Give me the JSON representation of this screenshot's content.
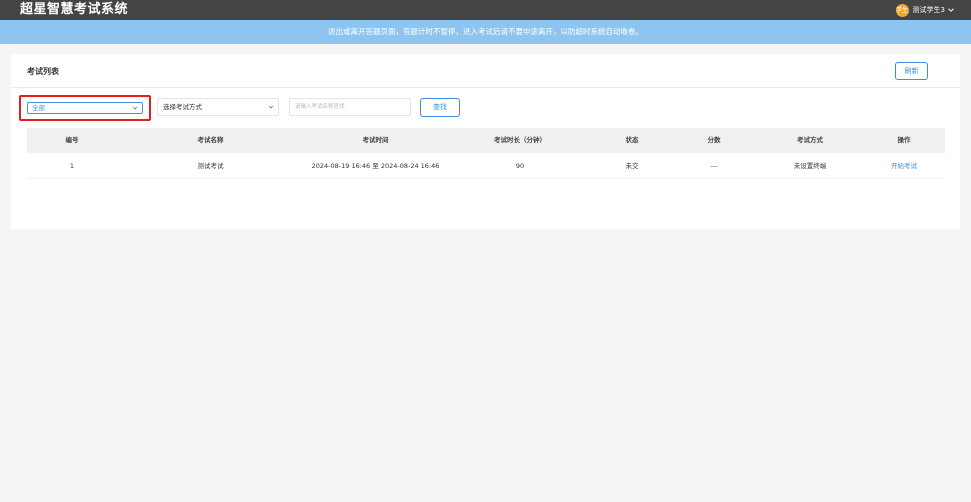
{
  "header": {
    "app_title": "超星智慧考试系统",
    "avatar_text": "学生",
    "user_name": "测试学生3"
  },
  "notice": "退出或离开答题页面，答题计时不暂停，进入考试后请不要中途离开，以防超时系统自动收卷。",
  "panel": {
    "title": "考试列表",
    "refresh_label": "刷新"
  },
  "filters": {
    "status_value": "全部",
    "mode_value": "选择考试方式",
    "search_placeholder": "请输入考试名称查找",
    "search_label": "查找"
  },
  "table": {
    "columns": [
      "编号",
      "考试名称",
      "考试时间",
      "考试时长（分钟）",
      "状态",
      "分数",
      "考试方式",
      "操作"
    ],
    "rows": [
      {
        "id": "1",
        "name": "测试考试",
        "time": "2024-08-19 16:46 至 2024-08-24 16:46",
        "duration": "90",
        "status": "未交",
        "score": "---",
        "mode": "未设置终端",
        "action": "开始考试"
      }
    ]
  },
  "colors": {
    "topbar": "#444444",
    "notice_bg": "#8ec5f0",
    "accent": "#3a8ee6",
    "highlight_border": "#e02020",
    "avatar": "#f5a623"
  },
  "icons": [
    "chevron-down-icon"
  ]
}
